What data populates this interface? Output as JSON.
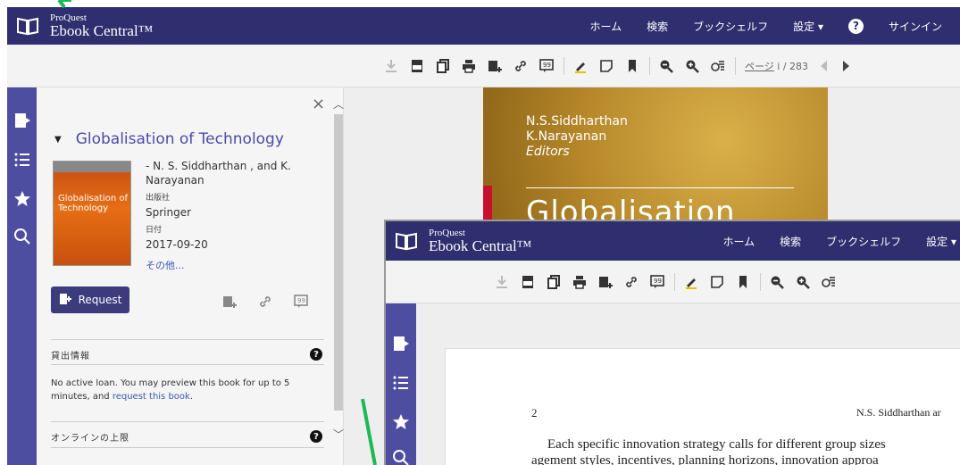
{
  "app": {
    "brand_top": "ProQuest",
    "brand_main": "Ebook Central™"
  },
  "nav": {
    "home": "ホーム",
    "search": "検索",
    "bookshelf": "ブックシェルフ",
    "settings": "設定 ▾",
    "help": "?",
    "signin": "サインイン"
  },
  "toolbar": {
    "page_label": "ページ",
    "page_current": "i",
    "page_total": "/ 283"
  },
  "panel": {
    "close": "×",
    "book_title": "Globalisation of Technology",
    "authors": "- N. S. Siddharthan , and K. Narayanan",
    "publisher_label": "出版社",
    "publisher": "Springer",
    "date_label": "日付",
    "date": "2017-09-20",
    "more": "その他...",
    "request_button": "Request",
    "loan_section": "貸出情報",
    "loan_text_prefix": "No active loan. You may preview this book for up to 5 minutes, and ",
    "loan_link": "request this book",
    "loan_text_suffix": ".",
    "online_section": "オンラインの上限"
  },
  "cover_thumb": {
    "title": "Globalisation of Technology"
  },
  "background_cover": {
    "author1": "N.S.Siddharthan",
    "author2": "K.Narayanan",
    "editors": "Editors",
    "title_partial": "Globalisation"
  },
  "inset": {
    "brand_top": "ProQuest",
    "brand_main": "Ebook Central™",
    "home": "ホーム",
    "search": "検索",
    "bookshelf": "ブックシェルフ",
    "settings": "設定 ▾",
    "page_number": "2",
    "running_head": "N.S. Siddharthan ar",
    "body_line1": "Each specific innovation strategy calls for different group sizes",
    "body_line2": "agement styles, incentives, planning horizons, innovation approa"
  },
  "colors": {
    "header": "#2f2e6e",
    "sidenav": "#4e4ea0",
    "accent_link": "#4a4aa8",
    "request_btn": "#3b3b7d",
    "annotation_line": "#1db954"
  }
}
